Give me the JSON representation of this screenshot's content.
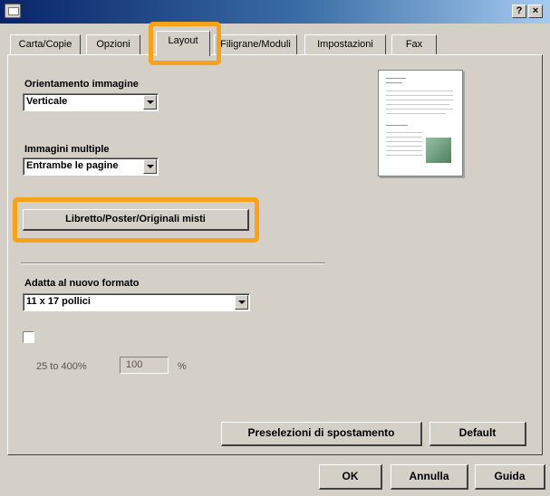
{
  "window": {
    "help_button": "?",
    "close_button": "×"
  },
  "tabs": [
    {
      "label": "Carta/Copie"
    },
    {
      "label": "Opzioni"
    },
    {
      "label": "Layout",
      "active": true
    },
    {
      "label": "Filigrane/Moduli"
    },
    {
      "label": "Impostazioni"
    },
    {
      "label": "Fax"
    }
  ],
  "orientation": {
    "label": "Orientamento immagine",
    "value": "Verticale"
  },
  "multiple_images": {
    "label": "Immagini multiple",
    "value": "Entrambe le pagine"
  },
  "booklet_button": "Libretto/Poster/Originali misti",
  "fit_to_format": {
    "label": "Adatta al nuovo formato",
    "value": "11 x 17 pollici"
  },
  "zoom": {
    "checked": false,
    "range_label": "25 to 400%",
    "value": "100",
    "unit": "%"
  },
  "buttons": {
    "shift_presets": "Preselezioni di spostamento",
    "default": "Default",
    "ok": "OK",
    "cancel": "Annulla",
    "help": "Guida"
  },
  "highlight_color": "#f7a21b"
}
